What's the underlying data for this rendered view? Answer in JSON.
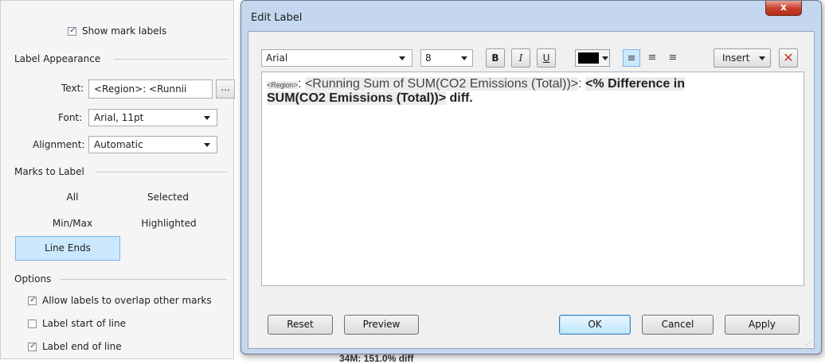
{
  "left_panel": {
    "show_mark_labels": {
      "label": "Show mark labels",
      "checked": true
    },
    "label_appearance": {
      "title": "Label Appearance",
      "text_label": "Text:",
      "text_value": "<Region>: <Runnii",
      "ellipsis": "...",
      "font_label": "Font:",
      "font_value": "Arial, 11pt",
      "alignment_label": "Alignment:",
      "alignment_value": "Automatic"
    },
    "marks_to_label": {
      "title": "Marks to Label",
      "all": "All",
      "selected": "Selected",
      "min_max": "Min/Max",
      "highlighted": "Highlighted",
      "line_ends": "Line Ends",
      "active": "Line Ends"
    },
    "options": {
      "title": "Options",
      "allow_overlap": {
        "label": "Allow labels to overlap other marks",
        "checked": true
      },
      "label_start": {
        "label": "Label start of line",
        "checked": false
      },
      "label_end": {
        "label": "Label end of line",
        "checked": true
      }
    }
  },
  "dialog": {
    "title": "Edit Label",
    "close": "x",
    "toolbar": {
      "font_family": "Arial",
      "font_size": "8",
      "bold": "B",
      "italic": "I",
      "underline": "U",
      "color": "#000000",
      "alignment_active": "left",
      "insert": "Insert",
      "clear": "✕"
    },
    "editor": {
      "region_token": "<Region>",
      "colon1": ": ",
      "running_sum_token": "<Running Sum of SUM(CO2 Emissions (Total))>",
      "colon2": ": ",
      "pct_token_line1": "<% Difference in",
      "pct_token_line2": "SUM(CO2 Emissions (Total))>",
      "diff_text": " diff."
    },
    "buttons": {
      "reset": "Reset",
      "preview": "Preview",
      "ok": "OK",
      "cancel": "Cancel",
      "apply": "Apply"
    }
  },
  "background": {
    "partial_label": "34M: 151.0% diff"
  }
}
